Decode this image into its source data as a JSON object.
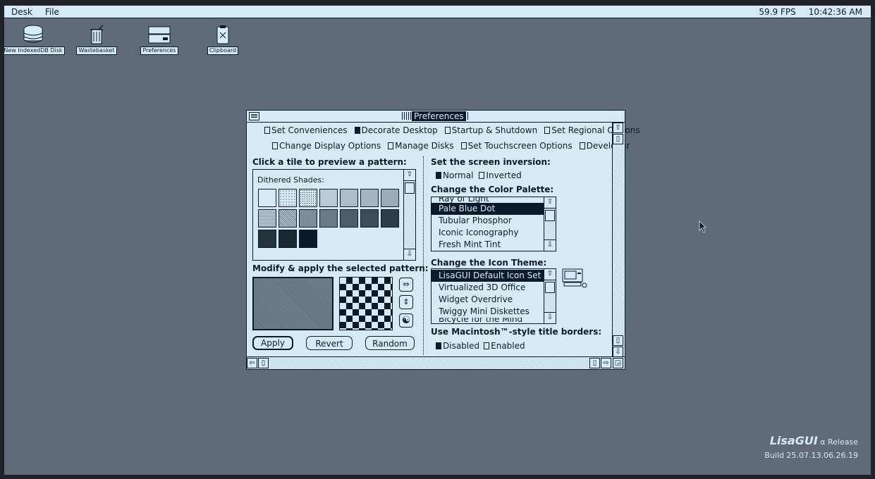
{
  "menubar": {
    "desk": "Desk",
    "file": "File",
    "fps": "59.9 FPS",
    "clock": "10:42:36 AM"
  },
  "desktop": {
    "icons": [
      {
        "label": "New IndexedDB Disk",
        "icon": "disk-icon"
      },
      {
        "label": "Wastebasket",
        "icon": "trash-icon"
      },
      {
        "label": "Preferences",
        "icon": "preferences-icon"
      },
      {
        "label": "Clipboard",
        "icon": "clipboard-icon"
      }
    ]
  },
  "window": {
    "title": "Preferences",
    "tabs_row1": [
      {
        "label": "Set Conveniences",
        "checked": false
      },
      {
        "label": "Decorate Desktop",
        "checked": true
      },
      {
        "label": "Startup & Shutdown",
        "checked": false
      },
      {
        "label": "Set Regional Options",
        "checked": false
      }
    ],
    "tabs_row2": [
      {
        "label": "Change Display Options",
        "checked": false
      },
      {
        "label": "Manage Disks",
        "checked": false
      },
      {
        "label": "Set Touchscreen Options",
        "checked": false
      },
      {
        "label": "Developer",
        "checked": false
      }
    ],
    "pattern": {
      "heading": "Click a tile to preview a pattern:",
      "group_title": "Dithered Shades:",
      "modify_heading": "Modify & apply the selected pattern:",
      "apply": "Apply",
      "revert": "Revert",
      "random": "Random"
    },
    "inversion": {
      "heading": "Set the screen inversion:",
      "normal": "Normal",
      "inverted": "Inverted",
      "selected": "Normal"
    },
    "palette": {
      "heading": "Change the Color Palette:",
      "items": [
        "Ray of Light",
        "Pale Blue Dot",
        "Tubular Phosphor",
        "Iconic Iconography",
        "Fresh Mint Tint"
      ],
      "selected": "Pale Blue Dot"
    },
    "icon_theme": {
      "heading": "Change the Icon Theme:",
      "items": [
        "LisaGUI Default Icon Set",
        "Virtualized 3D Office",
        "Widget Overdrive",
        "Twiggy Mini Diskettes",
        "Bicycle for the Mind"
      ],
      "selected": "LisaGUI Default Icon Set"
    },
    "title_borders": {
      "heading": "Use Macintosh™-style title borders:",
      "disabled": "Disabled",
      "enabled": "Enabled",
      "selected": "Disabled"
    }
  },
  "branding": {
    "logo": "LisaGUI",
    "release": "α Release",
    "build": "Build 25.07.13.06.26.19"
  },
  "colors": {
    "fg": "#0b1b2b",
    "bg": "#d6e9f7",
    "desktop": "#5f6b78"
  }
}
